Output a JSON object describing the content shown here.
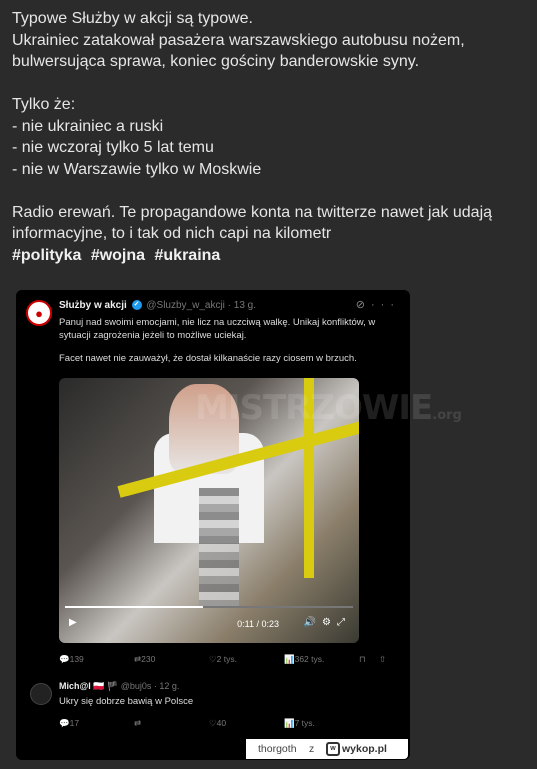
{
  "post": {
    "lines": [
      "Typowe Służby w akcji są typowe.",
      "Ukrainiec zatakował pasażera warszawskiego autobusu nożem,",
      "bulwersująca sprawa, koniec gościny banderowskie syny."
    ],
    "list_intro": "Tylko że:",
    "list": [
      "- nie ukrainiec a ruski",
      "- nie wczoraj tylko 5 lat temu",
      "- nie w Warszawie tylko w Moskwie"
    ],
    "closing": [
      "Radio erewań. Te propagandowe konta na twitterze nawet jak udają",
      "informacyjne, to i tak od nich capi na kilometr"
    ],
    "tags": [
      "#polityka",
      "#wojna",
      "#ukraina"
    ]
  },
  "tweet": {
    "name": "Służby w akcji",
    "handle": "@Sluzby_w_akcji · 13 g.",
    "text": "Panuj nad swoimi emocjami, nie licz na uczciwą walkę. Unikaj konfliktów, w sytuacji zagrożenia jeżeli to możliwe uciekaj.",
    "text2": "Facet nawet nie zauważył, że dostał kilkanaście razy ciosem w brzuch.",
    "video": {
      "time": "0:11 / 0:23",
      "progress": 0.48
    },
    "metrics": {
      "replies": "139",
      "retweets": "230",
      "likes": "2 tys.",
      "views": "362 tys."
    }
  },
  "reply": {
    "name": "Mich@l 🇵🇱 🏴",
    "handle": "@buj0s · 12 g.",
    "text": "Ukry się dobrze bawią w Polsce",
    "metrics": {
      "replies": "17",
      "retweets": "",
      "likes": "40",
      "views": "7 tys."
    }
  },
  "watermark": {
    "main": "MISTRZOWIE",
    "suffix": ".org"
  },
  "footer": {
    "user": "thorgoth",
    "z": "z",
    "logo": "wykop.pl"
  },
  "colors": {
    "background": "#2b2b2b",
    "accent_yellow": "#d9cc10",
    "verified": "#1d9bf0"
  }
}
